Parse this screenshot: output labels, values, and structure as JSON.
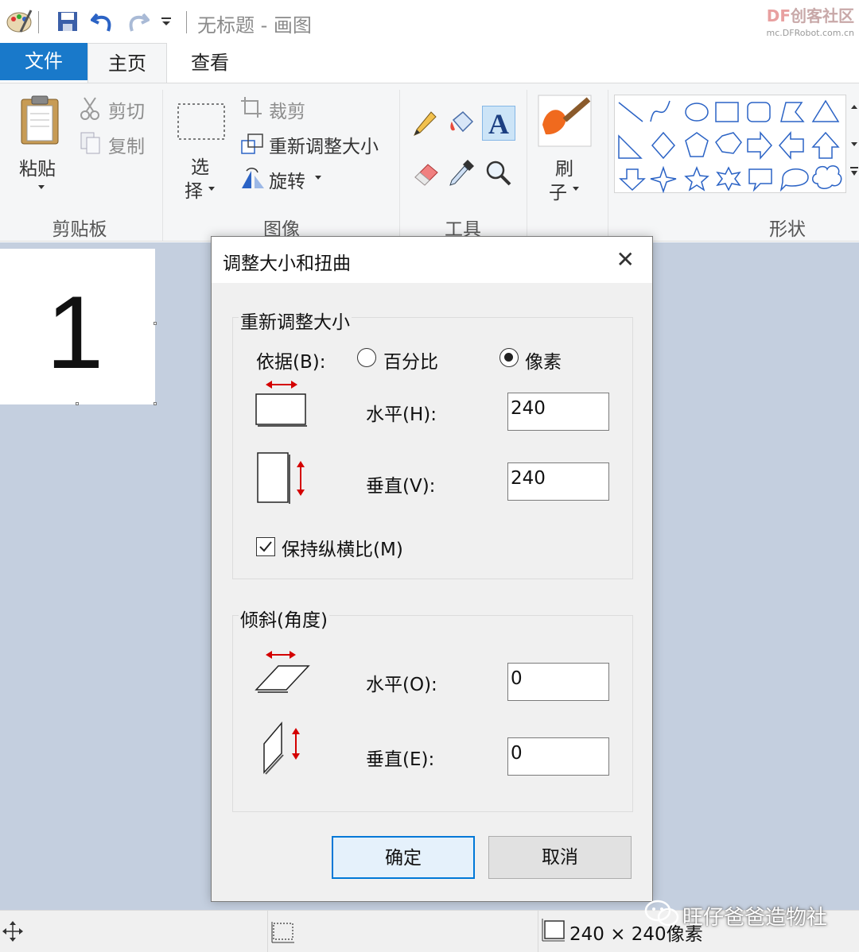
{
  "window": {
    "title": "无标题 - 画图"
  },
  "watermark_top": {
    "brand_df": "DF",
    "brand_text": "创客社区",
    "url": "mc.DFRobot.com.cn"
  },
  "tabs": {
    "file": "文件",
    "home": "主页",
    "view": "查看"
  },
  "ribbon": {
    "clipboard": {
      "label": "剪贴板",
      "paste": "粘贴",
      "cut": "剪切",
      "copy": "复制"
    },
    "image": {
      "label": "图像",
      "select_line1": "选",
      "select_line2": "择",
      "crop": "裁剪",
      "resize": "重新调整大小",
      "rotate": "旋转"
    },
    "tools": {
      "label": "工具"
    },
    "brushes": {
      "line1": "刷",
      "line2": "子"
    },
    "shapes": {
      "label": "形状"
    }
  },
  "canvas": {
    "content": "1"
  },
  "dialog": {
    "title": "调整大小和扭曲",
    "close": "✕",
    "resize": {
      "legend": "重新调整大小",
      "by_label": "依据(B):",
      "percent_label": "百分比",
      "pixels_label": "像素",
      "selected": "pixels",
      "horizontal_label": "水平(H):",
      "horizontal_value": "240",
      "vertical_label": "垂直(V):",
      "vertical_value": "240",
      "keep_ratio_label": "保持纵横比(M)",
      "keep_ratio_checked": true
    },
    "skew": {
      "legend": "倾斜(角度)",
      "horizontal_label": "水平(O):",
      "horizontal_value": "0",
      "vertical_label": "垂直(E):",
      "vertical_value": "0"
    },
    "ok": "确定",
    "cancel": "取消"
  },
  "statusbar": {
    "canvas_size": "240 × 240像素"
  },
  "watermark_bottom": {
    "text": "旺仔爸爸造物社"
  },
  "colors": {
    "accent": "#1979ca",
    "arrow_red": "#d40000",
    "workspace": "#c4cfdf"
  }
}
